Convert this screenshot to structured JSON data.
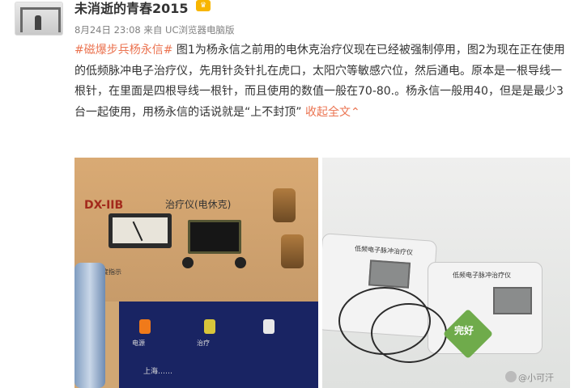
{
  "user": {
    "name": "未消逝的青春2015",
    "avatar_icon": "avatar-image",
    "badge_icon": "vip-crown-icon"
  },
  "meta": {
    "timestamp": "8月24日 23:08",
    "source": "来自 UC浏览器电脑版"
  },
  "post": {
    "hashtag": "#磁爆步兵杨永信#",
    "body": "图1为杨永信之前用的电休克治疗仪现在已经被强制停用，图2为现在正在使用的低频脉冲电子治疗仪，先用针灸针扎在虎口，太阳穴等敏感穴位，然后通电。原本是一根导线一根针，在里面是四根导线一根针，而且使用的数值一般在70-80.。杨永信一般用40，但是是最少3台一起使用，用杨永信的话说就是“上不封顶”",
    "collapse_label": "收起全文",
    "collapse_icon": "chevron-up-icon"
  },
  "photo1": {
    "device_model": "DX-IIB",
    "device_name": "治疗仪(电休克)",
    "strength_label": "强度指示",
    "power_label": "电源",
    "treatment_label": "治疗",
    "manufacturer": "上海……"
  },
  "photo2": {
    "device_title": "低频电子脉冲治疗仪",
    "heart_tag": "完好"
  },
  "watermark": "@小可汗"
}
